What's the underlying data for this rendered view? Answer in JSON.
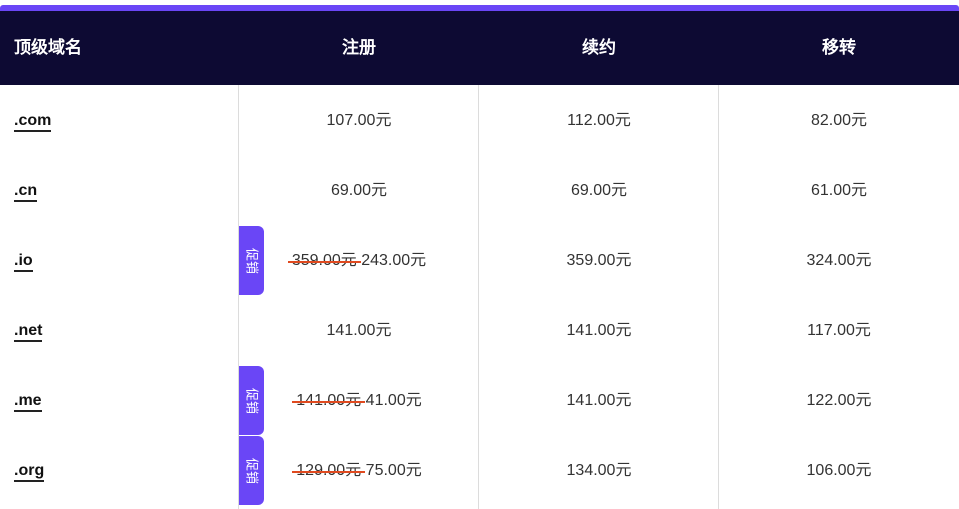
{
  "header": {
    "col_domain": "顶级域名",
    "col_register": "注册",
    "col_renew": "续约",
    "col_transfer": "移转"
  },
  "promo_label": "促销",
  "accent_color": "#6a46f6",
  "header_bg": "#0d0a33",
  "rows": [
    {
      "tld": ".com",
      "register": "107.00元",
      "register_old": "",
      "renew": "112.00元",
      "transfer": "82.00元"
    },
    {
      "tld": ".cn",
      "register": "69.00元",
      "register_old": "",
      "renew": "69.00元",
      "transfer": "61.00元"
    },
    {
      "tld": ".io",
      "register": "243.00元",
      "register_old": "359.00元",
      "renew": "359.00元",
      "transfer": "324.00元"
    },
    {
      "tld": ".net",
      "register": "141.00元",
      "register_old": "",
      "renew": "141.00元",
      "transfer": "117.00元"
    },
    {
      "tld": ".me",
      "register": "41.00元",
      "register_old": "141.00元",
      "renew": "141.00元",
      "transfer": "122.00元"
    },
    {
      "tld": ".org",
      "register": "75.00元",
      "register_old": "129.00元",
      "renew": "134.00元",
      "transfer": "106.00元"
    }
  ]
}
